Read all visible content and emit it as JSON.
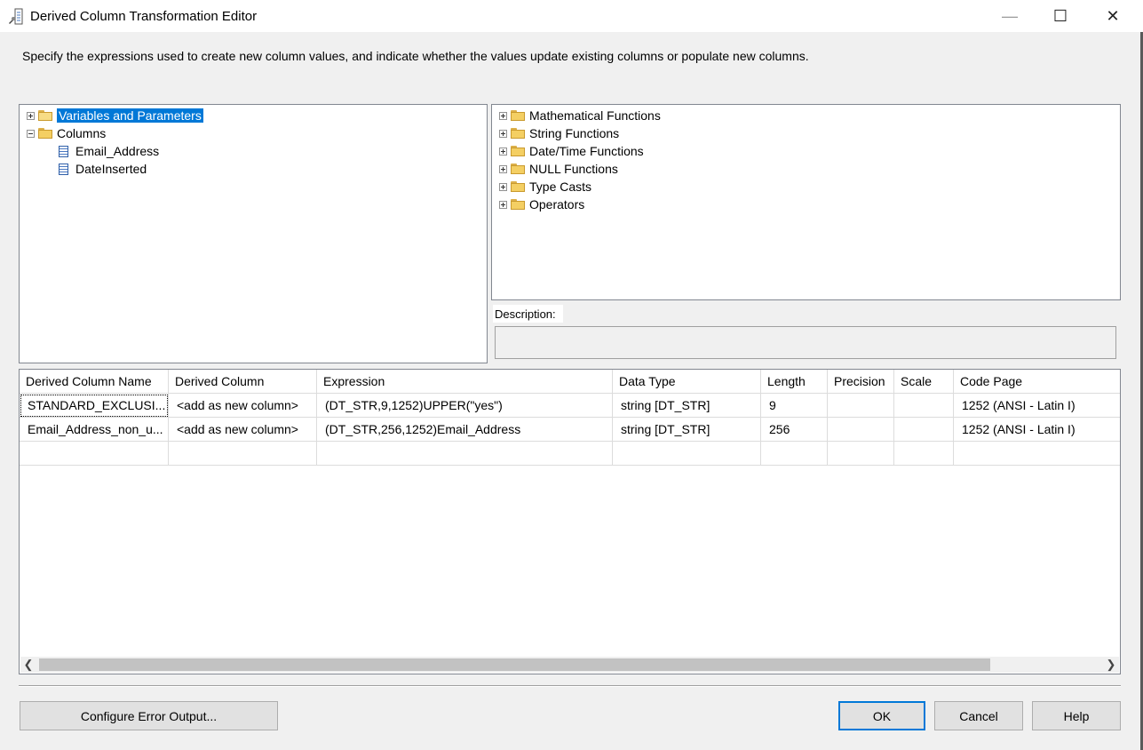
{
  "window": {
    "title": "Derived Column Transformation Editor",
    "icon": "derived-column-icon",
    "minimize_glyph": "—",
    "maximize_glyph": "☐",
    "close_glyph": "✕"
  },
  "subtitle": "Specify the expressions used to create new column values, and indicate whether the values update existing columns or populate new columns.",
  "left_tree": {
    "variables_label": "Variables and Parameters",
    "columns_label": "Columns",
    "columns": [
      "Email_Address",
      "DateInserted"
    ]
  },
  "right_tree": {
    "items": [
      "Mathematical Functions",
      "String Functions",
      "Date/Time Functions",
      "NULL Functions",
      "Type Casts",
      "Operators"
    ]
  },
  "description": {
    "label": "Description:",
    "value": ""
  },
  "grid": {
    "headers": [
      "Derived Column Name",
      "Derived Column",
      "Expression",
      "Data Type",
      "Length",
      "Precision",
      "Scale",
      "Code Page"
    ],
    "rows": [
      [
        "STANDARD_EXCLUSI...",
        "<add as new column>",
        "(DT_STR,9,1252)UPPER(\"yes\")",
        "string [DT_STR]",
        "9",
        "",
        "",
        "1252  (ANSI - Latin I)"
      ],
      [
        "Email_Address_non_u...",
        "<add as new column>",
        "(DT_STR,256,1252)Email_Address",
        "string [DT_STR]",
        "256",
        "",
        "",
        "1252  (ANSI - Latin I)"
      ],
      [
        "",
        "",
        "",
        "",
        "",
        "",
        "",
        ""
      ]
    ],
    "scroll_left": "❮",
    "scroll_right": "❯"
  },
  "buttons": {
    "configure_error": "Configure Error Output...",
    "ok": "OK",
    "cancel": "Cancel",
    "help": "Help"
  }
}
